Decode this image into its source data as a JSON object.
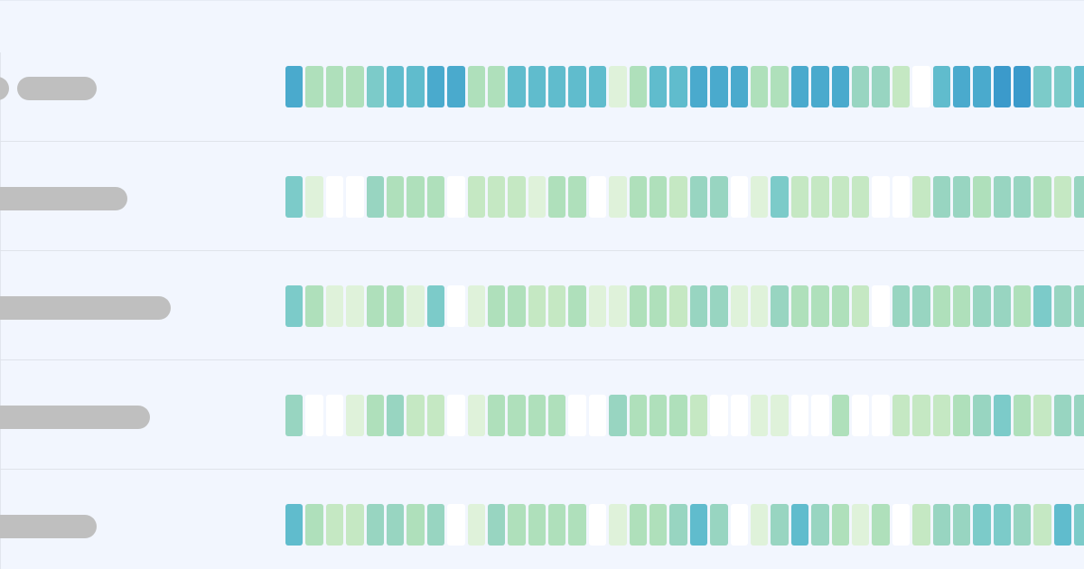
{
  "palette": [
    "#ffffff",
    "#dff2da",
    "#c5e8c3",
    "#afe0bb",
    "#98d5c1",
    "#7ccbc9",
    "#60bccd",
    "#4aaacd",
    "#3b9acb"
  ],
  "rows": [
    {
      "label_pills": 2,
      "levels": [
        7,
        3,
        3,
        3,
        5,
        6,
        6,
        7,
        7,
        3,
        3,
        6,
        6,
        6,
        6,
        6,
        1,
        3,
        6,
        6,
        7,
        7,
        7,
        3,
        3,
        7,
        7,
        7,
        4,
        4,
        2,
        0,
        6,
        7,
        7,
        8,
        8,
        5,
        5,
        6
      ]
    },
    {
      "label_pills": 1,
      "levels": [
        5,
        1,
        0,
        0,
        4,
        3,
        3,
        3,
        0,
        2,
        2,
        2,
        1,
        3,
        3,
        0,
        1,
        3,
        3,
        2,
        4,
        4,
        0,
        1,
        5,
        2,
        2,
        2,
        2,
        0,
        0,
        2,
        4,
        4,
        3,
        4,
        4,
        3,
        2,
        4
      ]
    },
    {
      "label_pills": 1,
      "levels": [
        5,
        3,
        1,
        1,
        3,
        3,
        1,
        5,
        0,
        1,
        3,
        3,
        2,
        2,
        3,
        1,
        1,
        3,
        3,
        2,
        4,
        4,
        1,
        1,
        4,
        3,
        3,
        3,
        2,
        0,
        4,
        4,
        3,
        3,
        4,
        4,
        3,
        5,
        4,
        4
      ]
    },
    {
      "label_pills": 1,
      "levels": [
        4,
        0,
        0,
        1,
        3,
        4,
        2,
        2,
        0,
        1,
        3,
        3,
        3,
        3,
        0,
        0,
        4,
        3,
        3,
        3,
        2,
        0,
        0,
        1,
        1,
        0,
        0,
        3,
        0,
        0,
        2,
        2,
        2,
        3,
        4,
        5,
        3,
        2,
        4,
        4
      ]
    },
    {
      "label_pills": 1,
      "levels": [
        6,
        3,
        2,
        2,
        4,
        4,
        3,
        4,
        0,
        1,
        4,
        3,
        3,
        3,
        3,
        0,
        1,
        3,
        3,
        4,
        6,
        4,
        0,
        1,
        4,
        6,
        4,
        3,
        1,
        3,
        0,
        2,
        4,
        4,
        5,
        5,
        4,
        2,
        6,
        5
      ]
    }
  ]
}
